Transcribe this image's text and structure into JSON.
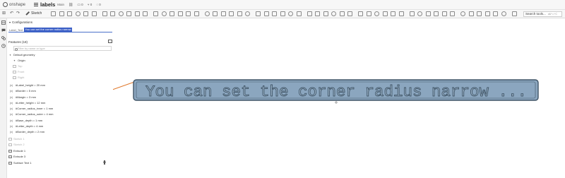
{
  "app": {
    "logo_text": "onshape",
    "document_title": "labels",
    "branch": "Main"
  },
  "topbar_icons": [
    {
      "name": "link-icon",
      "glyph": "⛓",
      "count": ""
    },
    {
      "name": "versions-icon",
      "glyph": "▭",
      "count": "0"
    },
    {
      "name": "branches-icon",
      "glyph": "⑂",
      "count": "0"
    },
    {
      "name": "comments-icon",
      "glyph": "◌",
      "count": "0"
    }
  ],
  "toolbar": {
    "sketch_label": "Sketch",
    "search_placeholder": "Search tools...",
    "search_shortcut": "alt/⌥+C"
  },
  "configurations": {
    "title": "Configurations",
    "input_label": "Label_Text",
    "input_value": "You can set the corner radius narrow"
  },
  "features": {
    "title": "Features (18)",
    "filter_placeholder": "Filter by name or type",
    "items": [
      {
        "label": "Default geometry",
        "type": "group",
        "dim": false
      },
      {
        "label": "Origin",
        "type": "origin",
        "dim": false
      },
      {
        "label": "Top",
        "type": "plane",
        "dim": true
      },
      {
        "label": "Front",
        "type": "plane",
        "dim": true
      },
      {
        "label": "Right",
        "type": "plane",
        "dim": true
      },
      {
        "label": "#Label_height = 20 mm",
        "type": "variable",
        "dim": false
      },
      {
        "label": "#Border = 5 mm",
        "type": "variable",
        "dim": false
      },
      {
        "label": "#Margin = 3 mm",
        "type": "variable",
        "dim": false
      },
      {
        "label": "#Letter_height = 12 mm",
        "type": "variable",
        "dim": false
      },
      {
        "label": "#Corner_radius_inner = 1 mm",
        "type": "variable",
        "dim": false
      },
      {
        "label": "#Corner_radius_outer = 4 mm",
        "type": "variable",
        "dim": false
      },
      {
        "label": "#Base_depth = 1 mm",
        "type": "variable",
        "dim": false
      },
      {
        "label": "#Letter_depth = 4 mm",
        "type": "variable",
        "dim": false
      },
      {
        "label": "#Border_depth = 2 mm",
        "type": "variable",
        "dim": false
      },
      {
        "label": "Sketch 1",
        "type": "sketch",
        "dim": true
      },
      {
        "label": "Sketch 2",
        "type": "sketch",
        "dim": true
      },
      {
        "label": "Extrude 1",
        "type": "feature",
        "dim": false
      },
      {
        "label": "Extrude 3",
        "type": "feature",
        "dim": false
      },
      {
        "label": "Surface Text 1",
        "type": "feature",
        "dim": false
      }
    ]
  },
  "canvas": {
    "label_text": "You can set the corner radius narrow ...",
    "annotation_color": "#e07a2e",
    "label_fill": "#8ba6bf",
    "label_edge": "#3f5466"
  }
}
